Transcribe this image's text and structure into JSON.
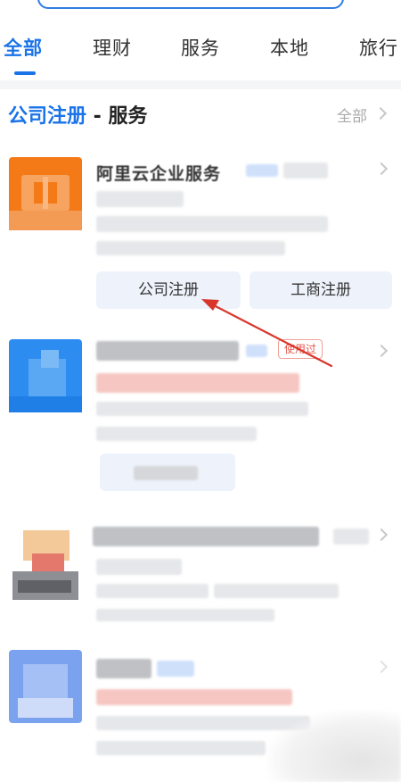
{
  "tabs": [
    {
      "label": "全部"
    },
    {
      "label": "理财"
    },
    {
      "label": "服务"
    },
    {
      "label": "本地"
    },
    {
      "label": "旅行"
    }
  ],
  "section": {
    "title_keyword": "公司注册",
    "title_rest": " - 服务",
    "all_label": "全部"
  },
  "cards": [
    {
      "name": "阿里云企业服务",
      "buttons": [
        "公司注册",
        "工商注册"
      ]
    },
    {
      "used_tag": "使用过"
    }
  ],
  "colors": {
    "accent": "#1a73e8",
    "annotation_arrow": "#d9362b"
  }
}
